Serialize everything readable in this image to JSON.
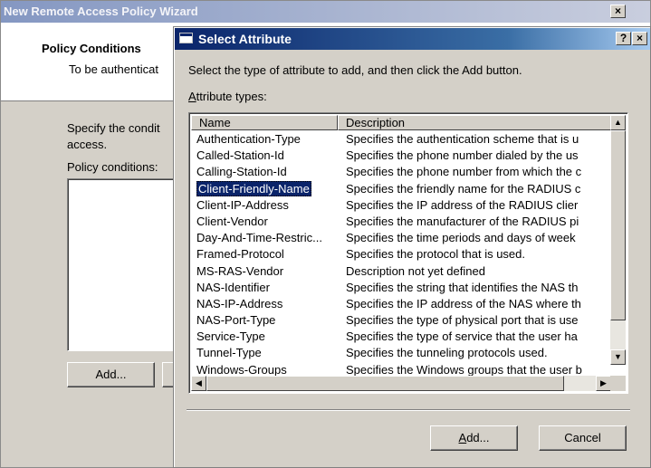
{
  "outer": {
    "title": "New Remote Access Policy Wizard",
    "close": "×",
    "header_title": "Policy Conditions",
    "header_subtitle": "To be authenticat",
    "body_text_line1": "Specify the condit",
    "body_text_line2": "access.",
    "conditions_label": "Policy conditions:",
    "add_button": "Add..."
  },
  "dialog": {
    "title": "Select Attribute",
    "help": "?",
    "close": "×",
    "instruction": "Select the type of attribute to add, and then click the Add button.",
    "list_label": "Attribute types:",
    "columns": [
      "Name",
      "Description"
    ],
    "rows": [
      {
        "name": "Authentication-Type",
        "desc": "Specifies the authentication scheme that is u"
      },
      {
        "name": "Called-Station-Id",
        "desc": "Specifies the phone number dialed by the us"
      },
      {
        "name": "Calling-Station-Id",
        "desc": "Specifies the phone number from which the c"
      },
      {
        "name": "Client-Friendly-Name",
        "desc": "Specifies the friendly name for the RADIUS c"
      },
      {
        "name": "Client-IP-Address",
        "desc": "Specifies the IP address of the RADIUS clier"
      },
      {
        "name": "Client-Vendor",
        "desc": "Specifies the manufacturer of the RADIUS pi"
      },
      {
        "name": "Day-And-Time-Restric...",
        "desc": "Specifies the time periods and days of week"
      },
      {
        "name": "Framed-Protocol",
        "desc": "Specifies the protocol that is used."
      },
      {
        "name": "MS-RAS-Vendor",
        "desc": "Description not yet defined"
      },
      {
        "name": "NAS-Identifier",
        "desc": "Specifies the string that identifies the NAS th"
      },
      {
        "name": "NAS-IP-Address",
        "desc": "Specifies the IP address of the NAS where th"
      },
      {
        "name": "NAS-Port-Type",
        "desc": "Specifies the type of physical port that is use"
      },
      {
        "name": "Service-Type",
        "desc": "Specifies the type of service that the user ha"
      },
      {
        "name": "Tunnel-Type",
        "desc": "Specifies the tunneling protocols used."
      },
      {
        "name": "Windows-Groups",
        "desc": "Specifies the Windows groups that the user b"
      }
    ],
    "selected_row": "Client-Friendly-Name",
    "add_button": "Add...",
    "cancel_button": "Cancel"
  }
}
